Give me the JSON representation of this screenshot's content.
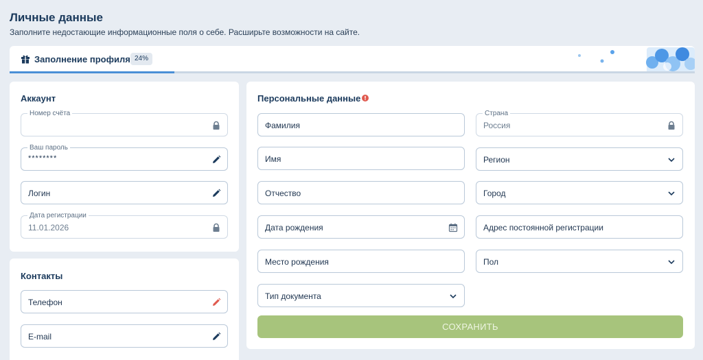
{
  "header": {
    "title": "Личные данные",
    "subtitle": "Заполните недостающие информационные поля о себе. Расширьте возможности на сайте."
  },
  "profile_progress": {
    "label": "Заполнение профиля",
    "percent_text": "24%",
    "percent": 24,
    "icon": "gift-icon"
  },
  "account": {
    "title": "Аккаунт",
    "account_number": {
      "legend": "Номер счёта",
      "value": "",
      "icon": "lock-icon"
    },
    "password": {
      "legend": "Ваш пароль",
      "value": "********",
      "icon": "pencil-icon"
    },
    "login": {
      "value": "Логин",
      "icon": "pencil-icon"
    },
    "registration_date": {
      "legend": "Дата регистрации",
      "value": "11.01.2026",
      "icon": "lock-icon"
    }
  },
  "contacts": {
    "title": "Контакты",
    "phone": {
      "value": "Телефон",
      "icon": "pencil-icon",
      "icon_color": "#e05a4f"
    },
    "email": {
      "value": "E-mail",
      "icon": "pencil-icon"
    }
  },
  "personal": {
    "title": "Персональные данные",
    "warning_icon": "exclamation-icon",
    "warning_color": "#e05a4f",
    "surname": "Фамилия",
    "name": "Имя",
    "patronymic": "Отчество",
    "birth_date": "Дата рождения",
    "birth_place": "Место рождения",
    "document_type": "Тип документа",
    "country": {
      "legend": "Страна",
      "value": "Россия",
      "icon": "lock-icon"
    },
    "region": "Регион",
    "city": "Город",
    "address": "Адрес постоянной регистрации",
    "gender": "Пол"
  },
  "save_button": {
    "label": "СОХРАНИТЬ",
    "color": "#a7c47c"
  },
  "colors": {
    "accent": "#4a8fd6",
    "title": "#1b3a5c",
    "background": "#e8edf3"
  }
}
